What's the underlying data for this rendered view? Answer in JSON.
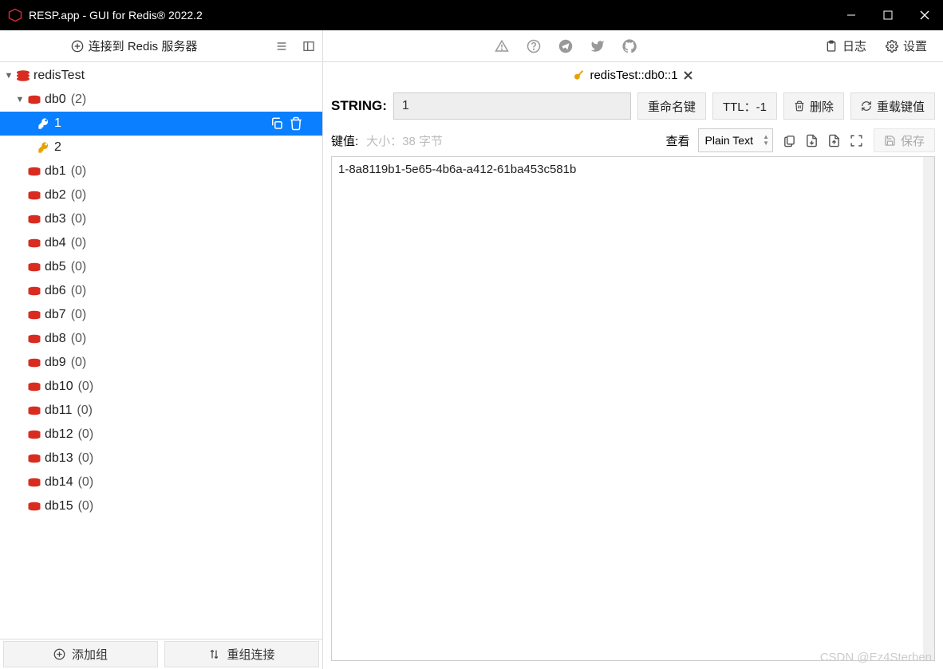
{
  "window": {
    "title": "RESP.app - GUI for Redis® 2022.2"
  },
  "toolbar": {
    "connect_label": "连接到 Redis 服务器",
    "log_label": "日志",
    "settings_label": "设置"
  },
  "sidebar": {
    "server": {
      "name": "redisTest"
    },
    "databases": [
      {
        "name": "db0",
        "count": "(2)",
        "expanded": true,
        "keys": [
          {
            "name": "1",
            "selected": true
          },
          {
            "name": "2",
            "selected": false
          }
        ]
      },
      {
        "name": "db1",
        "count": "(0)"
      },
      {
        "name": "db2",
        "count": "(0)"
      },
      {
        "name": "db3",
        "count": "(0)"
      },
      {
        "name": "db4",
        "count": "(0)"
      },
      {
        "name": "db5",
        "count": "(0)"
      },
      {
        "name": "db6",
        "count": "(0)"
      },
      {
        "name": "db7",
        "count": "(0)"
      },
      {
        "name": "db8",
        "count": "(0)"
      },
      {
        "name": "db9",
        "count": "(0)"
      },
      {
        "name": "db10",
        "count": "(0)"
      },
      {
        "name": "db11",
        "count": "(0)"
      },
      {
        "name": "db12",
        "count": "(0)"
      },
      {
        "name": "db13",
        "count": "(0)"
      },
      {
        "name": "db14",
        "count": "(0)"
      },
      {
        "name": "db15",
        "count": "(0)"
      }
    ],
    "footer": {
      "add_group": "添加组",
      "reorder": "重组连接"
    }
  },
  "tab": {
    "title": "redisTest::db0::1"
  },
  "keyview": {
    "type_label": "STRING:",
    "key_name": "1",
    "rename_label": "重命名键",
    "ttl_label": "TTL：-1",
    "delete_label": "删除",
    "reload_label": "重载键值",
    "value_label": "键值:",
    "size_label": "大小：38 字节",
    "view_label": "查看",
    "view_mode": "Plain Text",
    "save_label": "保存",
    "value": "1-8a8119b1-5e65-4b6a-a412-61ba453c581b"
  },
  "watermark": "CSDN @Ez4Sterben"
}
